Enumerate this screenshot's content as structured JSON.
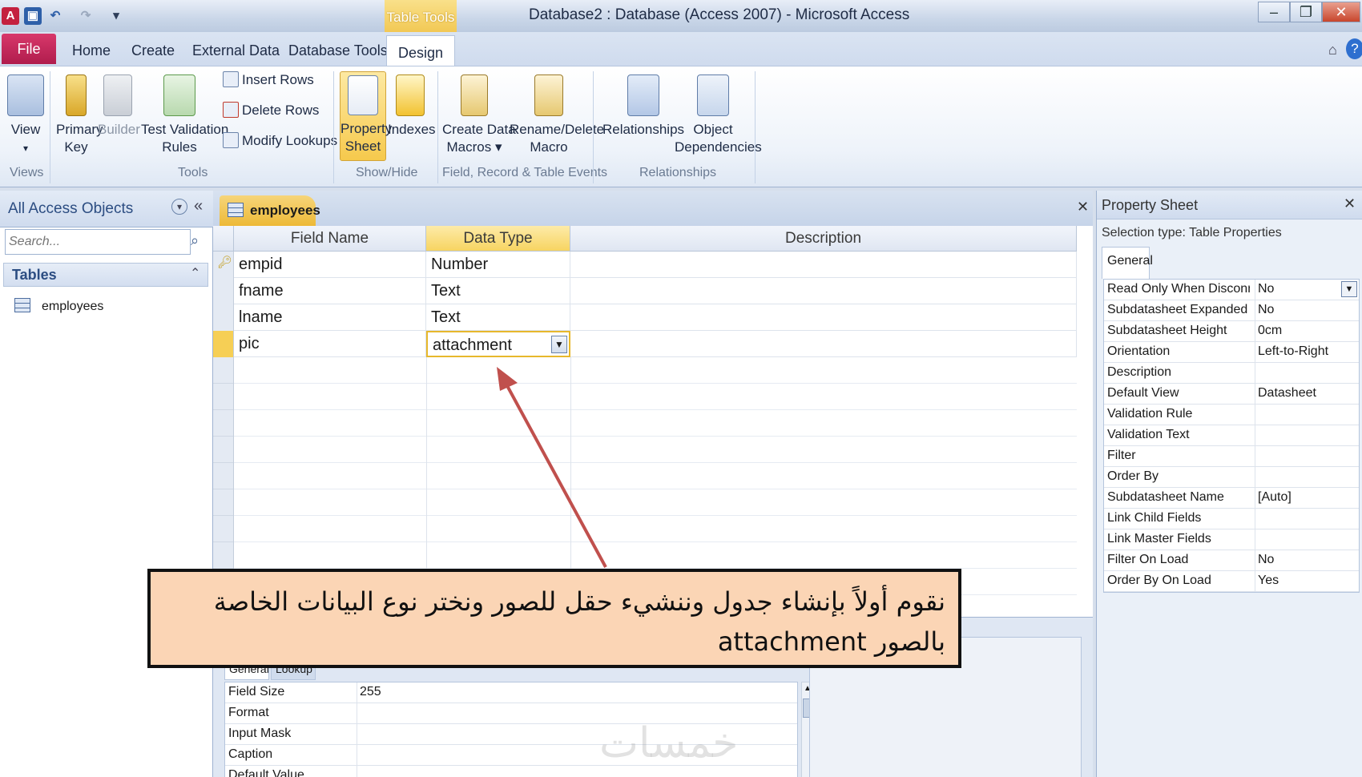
{
  "window": {
    "title": "Database2 : Database (Access 2007)  -  Microsoft Access",
    "context_tab": "Table Tools",
    "controls": {
      "minimize": "–",
      "restore": "❐",
      "close": "✕"
    }
  },
  "quick_access": {
    "app_icon": "A",
    "undo": "↶",
    "redo": "↷"
  },
  "ribbon_tabs": {
    "file": "File",
    "home": "Home",
    "create": "Create",
    "external_data": "External Data",
    "database_tools": "Database Tools",
    "design": "Design"
  },
  "ribbon": {
    "views": {
      "view": "View",
      "group": "Views"
    },
    "tools": {
      "primary_key": "Primary\nKey",
      "builder": "Builder",
      "test_validation": "Test Validation\nRules",
      "insert_rows": "Insert Rows",
      "delete_rows": "Delete Rows",
      "modify_lookups": "Modify Lookups",
      "group": "Tools"
    },
    "show_hide": {
      "property_sheet": "Property\nSheet",
      "indexes": "Indexes",
      "group": "Show/Hide"
    },
    "events": {
      "create_data_macros": "Create Data\nMacros ▾",
      "rename_delete_macro": "Rename/Delete\nMacro",
      "group": "Field, Record & Table Events"
    },
    "relationships": {
      "relationships": "Relationships",
      "object_dependencies": "Object\nDependencies",
      "group": "Relationships"
    }
  },
  "nav_pane": {
    "header": "All Access Objects",
    "search_placeholder": "Search...",
    "section": "Tables",
    "items": [
      {
        "label": "employees"
      }
    ]
  },
  "document": {
    "tab": "employees",
    "columns": {
      "field_name": "Field Name",
      "data_type": "Data Type",
      "description": "Description"
    },
    "rows": [
      {
        "field": "empid",
        "type": "Number"
      },
      {
        "field": "fname",
        "type": "Text"
      },
      {
        "field": "lname",
        "type": "Text"
      },
      {
        "field": "pic",
        "type": "attachment"
      }
    ]
  },
  "field_properties": {
    "tabs": {
      "general": "General",
      "lookup": "Lookup"
    },
    "rows": [
      {
        "key": "Field Size",
        "value": "255"
      },
      {
        "key": "Format",
        "value": ""
      },
      {
        "key": "Input Mask",
        "value": ""
      },
      {
        "key": "Caption",
        "value": ""
      },
      {
        "key": "Default Value",
        "value": ""
      }
    ]
  },
  "property_sheet": {
    "title": "Property Sheet",
    "selection_type": "Selection type:  Table Properties",
    "tab": "General",
    "rows": [
      {
        "key": "Read Only When Disconnected",
        "value": "No"
      },
      {
        "key": "Subdatasheet Expanded",
        "value": "No"
      },
      {
        "key": "Subdatasheet Height",
        "value": "0cm"
      },
      {
        "key": "Orientation",
        "value": "Left-to-Right"
      },
      {
        "key": "Description",
        "value": ""
      },
      {
        "key": "Default View",
        "value": "Datasheet"
      },
      {
        "key": "Validation Rule",
        "value": ""
      },
      {
        "key": "Validation Text",
        "value": ""
      },
      {
        "key": "Filter",
        "value": ""
      },
      {
        "key": "Order By",
        "value": ""
      },
      {
        "key": "Subdatasheet Name",
        "value": "[Auto]"
      },
      {
        "key": "Link Child Fields",
        "value": ""
      },
      {
        "key": "Link Master Fields",
        "value": ""
      },
      {
        "key": "Filter On Load",
        "value": "No"
      },
      {
        "key": "Order By On Load",
        "value": "Yes"
      }
    ]
  },
  "annotation": {
    "text": "نقوم أولاً بإنشاء جدول وننشيء حقل للصور ونختر نوع البيانات الخاصة بالصور attachment",
    "arrow_color": "#c0504d"
  },
  "watermark": "خمسات",
  "colors": {
    "file_tab": "#b01c4d",
    "accent": "#f1c64f",
    "ribbon_text": "#1e2b45"
  }
}
